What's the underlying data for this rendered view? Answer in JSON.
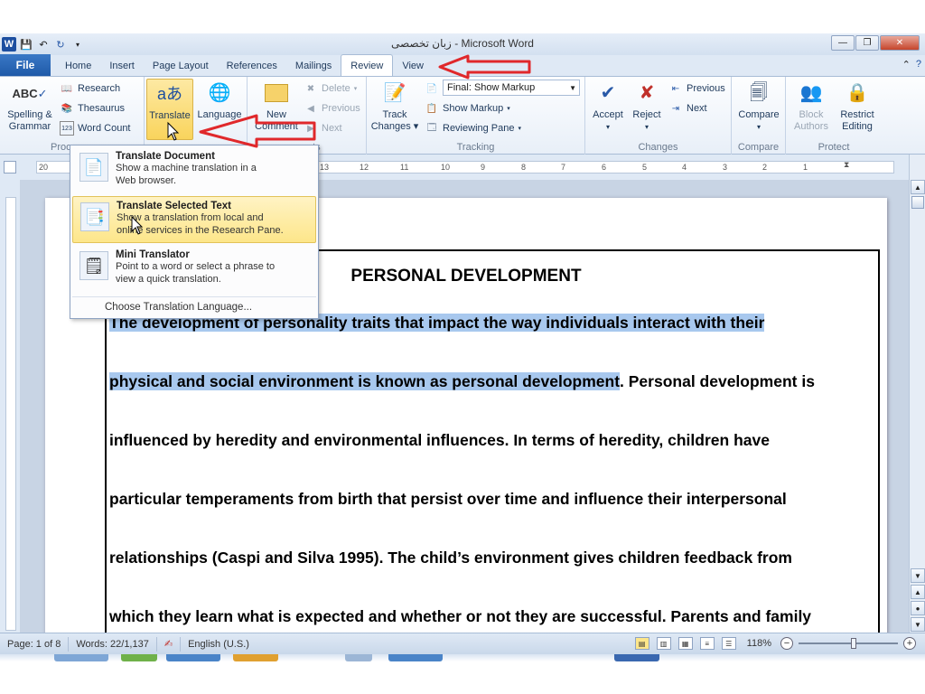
{
  "window": {
    "title": "زبان تخصصی  - Microsoft Word",
    "minimize": "—",
    "restore": "❐",
    "close": "✕"
  },
  "tabs": [
    "File",
    "Home",
    "Insert",
    "Page Layout",
    "References",
    "Mailings",
    "Review",
    "View"
  ],
  "active_tab": "Review",
  "ribbon": {
    "proofing": {
      "spelling": "Spelling &",
      "grammar": "Grammar",
      "research": "Research",
      "thesaurus": "Thesaurus",
      "word_count": "Word Count",
      "label": "Proo"
    },
    "language": {
      "translate": "Translate",
      "language": "Language"
    },
    "comments": {
      "new_comment_1": "New",
      "new_comment_2": "Comment",
      "delete": "Delete",
      "previous": "Previous",
      "next": "Next",
      "label": "nts"
    },
    "tracking": {
      "track_changes_1": "Track",
      "track_changes_2": "Changes",
      "markup_select": "Final: Show Markup",
      "show_markup": "Show Markup",
      "reviewing_pane": "Reviewing Pane",
      "label": "Tracking"
    },
    "changes": {
      "accept": "Accept",
      "reject": "Reject",
      "previous": "Previous",
      "next": "Next",
      "label": "Changes"
    },
    "compare": {
      "compare": "Compare",
      "label": "Compare"
    },
    "protect": {
      "block_authors_1": "Block",
      "block_authors_2": "Authors",
      "restrict_editing_1": "Restrict",
      "restrict_editing_2": "Editing",
      "label": "Protect"
    }
  },
  "translate_menu": {
    "items": [
      {
        "title": "Translate Document",
        "desc1": "Show a machine translation in a",
        "desc2": "Web browser."
      },
      {
        "title": "Translate Selected Text",
        "desc1": "Show a translation from local and",
        "desc2": "online services in the Research Pane."
      },
      {
        "title": "Mini Translator",
        "desc1": "Point to a word or select a phrase to",
        "desc2": "view a quick translation."
      }
    ],
    "footer": "Choose Translation Language..."
  },
  "ruler": {
    "labels": [
      "20",
      "13",
      "12",
      "11",
      "10",
      "9",
      "8",
      "7",
      "6",
      "5",
      "4",
      "3",
      "2",
      "1"
    ]
  },
  "document": {
    "title": "PERSONAL DEVELOPMENT",
    "lines": [
      {
        "sel": "The development of personality traits that impact the way individuals  interact with their",
        "rest": ""
      },
      {
        "sel": "physical and social environment is  known as personal development",
        "rest": ". Personal development is"
      },
      {
        "sel": "",
        "rest": "influenced by heredity and environmental influences. In terms of heredity, children have"
      },
      {
        "sel": "",
        "rest": "particular temperaments from birth that persist over time and influence their interpersonal"
      },
      {
        "sel": "",
        "rest": "relationships (Caspi and Silva 1995). The child’s environment gives children feedback from"
      },
      {
        "sel": "",
        "rest": "which they learn what is expected and whether or not they are successful. Parents and family"
      }
    ]
  },
  "status": {
    "page": "Page: 1 of 8",
    "words": "Words: 22/1,137",
    "language": "English (U.S.)",
    "zoom": "118%"
  },
  "colors": {
    "selection": "#a8c8ee",
    "arrow": "#e0282b",
    "file_tab": "#2b66b5"
  }
}
